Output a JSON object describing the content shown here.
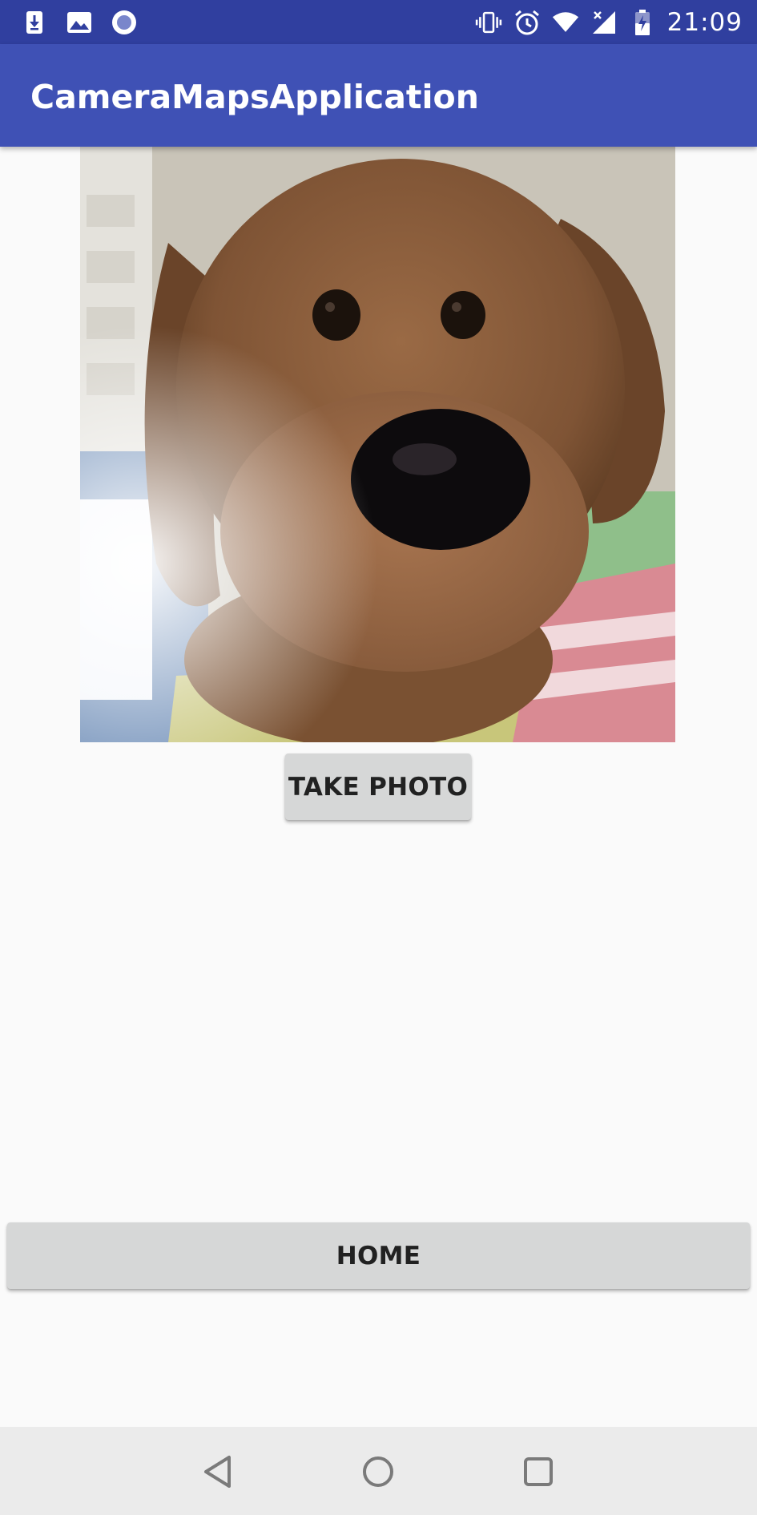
{
  "status_bar": {
    "time": "21:09",
    "left_icons": [
      "download-notification-icon",
      "image-notification-icon",
      "record-notification-icon"
    ],
    "right_icons": [
      "vibrate-icon",
      "alarm-icon",
      "wifi-icon",
      "cellular-signal-icon",
      "battery-icon"
    ]
  },
  "app_bar": {
    "title": "CameraMapsApplication",
    "color": "#3f51b5",
    "status_color": "#303f9f"
  },
  "photo": {
    "subject": "brown plush dog toy"
  },
  "buttons": {
    "take_photo": "TAKE PHOTO",
    "home": "HOME"
  },
  "nav_bar": {
    "icons": [
      "back-icon",
      "home-icon",
      "recents-icon"
    ]
  }
}
